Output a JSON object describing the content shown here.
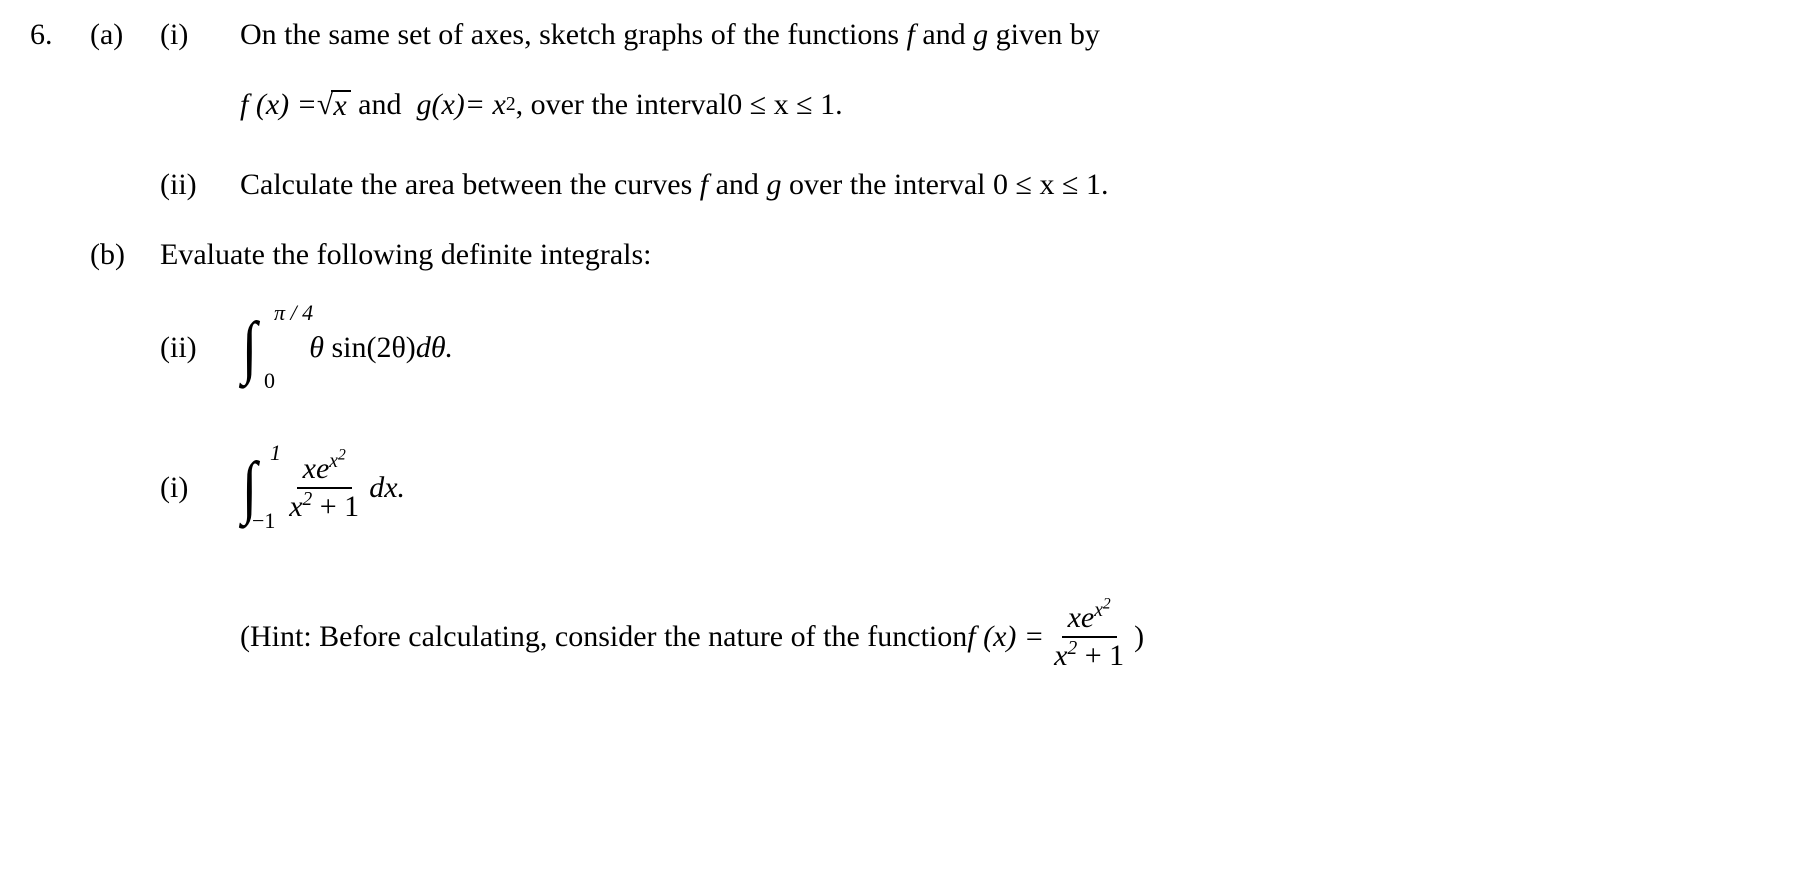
{
  "q": {
    "number": "6.",
    "a": {
      "letter": "(a)",
      "i": {
        "roman": "(i)",
        "line1_pre": "On the same set of axes, sketch graphs of the functions ",
        "line1_f": "f",
        "line1_mid": " and ",
        "line1_g": "g",
        "line1_post": " given by",
        "eq_f_lhs": "f (x) = ",
        "eq_f_arg": "x",
        "eq_and": " and  ",
        "eq_g": "g(x)= x",
        "eq_g_exp": "2",
        "eq_interval_pre": " , over the interval ",
        "eq_interval": "0 ≤ x ≤ 1",
        "eq_period": "."
      },
      "ii": {
        "roman": "(ii)",
        "text_pre": "Calculate the area between the curves ",
        "text_f": "f",
        "text_mid": " and ",
        "text_g": "g",
        "text_post": " over the interval ",
        "interval": "0 ≤ x ≤ 1",
        "period": "."
      }
    },
    "b": {
      "letter": "(b)",
      "intro": "Evaluate the following definite integrals:",
      "ii": {
        "roman": "(ii)",
        "upper": "π / 4",
        "lower": "0",
        "integrand_pre": "θ",
        "integrand_sin": "sin(2θ)",
        "integrand_d": "dθ.",
        "spacer": " "
      },
      "i": {
        "roman": "(i)",
        "upper": "1",
        "lower": "−1",
        "num_a": "xe",
        "num_exp_base": "x",
        "num_exp_pow": "2",
        "den_a": "x",
        "den_exp": "2",
        "den_rest": " + 1",
        "dx": "dx.",
        "hint_pre": "(Hint: Before calculating, consider the nature of the function  ",
        "hint_f": "f (x) = ",
        "hint_close": ")"
      }
    }
  }
}
